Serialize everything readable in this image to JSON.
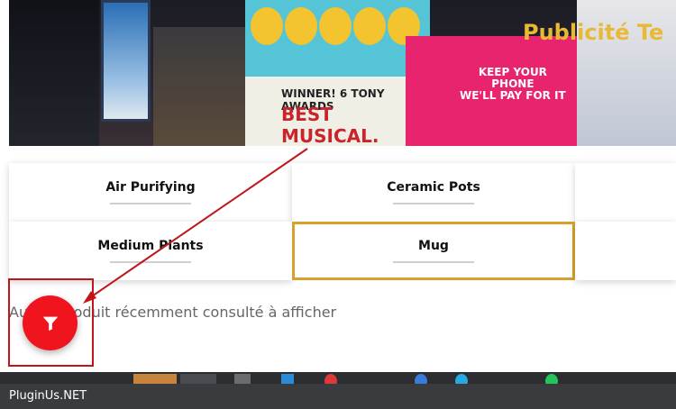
{
  "banner": {
    "board_line1": "WINNER! 6 TONY AWARDS",
    "board_line2": "BEST MUSICAL.",
    "pink_line1": "KEEP YOUR",
    "pink_line2": "PHONE",
    "pink_line3": "WE'LL PAY FOR IT",
    "overlay_title": "Publicité Te"
  },
  "categories": [
    {
      "label": "Air Purifying"
    },
    {
      "label": "Ceramic Pots"
    },
    {
      "label": ""
    },
    {
      "label": "Medium Plants"
    },
    {
      "label": "Mug"
    },
    {
      "label": ""
    }
  ],
  "empty_message": "Aucun produit récemment consulté à afficher",
  "fab": {
    "icon": "filter-icon",
    "color": "#f0141e"
  },
  "annotation": {
    "color": "#c0151b"
  },
  "selected_border_color": "#d9a02c",
  "footer": {
    "brand": "PluginUs.NET"
  }
}
